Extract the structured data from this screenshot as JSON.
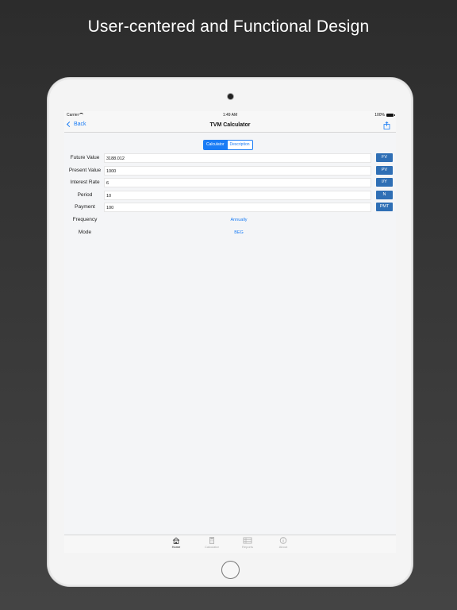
{
  "headline": "User-centered and Functional Design",
  "status_bar": {
    "carrier": "Carrier",
    "time": "1:49 AM",
    "battery": "100%"
  },
  "nav": {
    "back_label": "Back",
    "title": "TVM Calculator"
  },
  "segments": [
    {
      "label": "Calculator",
      "selected": true
    },
    {
      "label": "Description",
      "selected": false
    }
  ],
  "fields": [
    {
      "label": "Future Value",
      "value": "3188.012",
      "button": "FV"
    },
    {
      "label": "Present Value",
      "value": "1000",
      "button": "PV"
    },
    {
      "label": "Interest Rate",
      "value": "6",
      "button": "I/Y"
    },
    {
      "label": "Period",
      "value": "10",
      "button": "N"
    },
    {
      "label": "Payment",
      "value": "100",
      "button": "PMT"
    }
  ],
  "options": [
    {
      "label": "Frequency",
      "value": "Annually"
    },
    {
      "label": "Mode",
      "value": "BEG"
    }
  ],
  "tabs": [
    {
      "label": "Home",
      "icon": "home-icon",
      "active": true
    },
    {
      "label": "Calculator",
      "icon": "calculator-icon",
      "active": false
    },
    {
      "label": "Reports",
      "icon": "reports-icon",
      "active": false
    },
    {
      "label": "About",
      "icon": "info-icon",
      "active": false
    }
  ],
  "colors": {
    "accent": "#1a7cf5",
    "button": "#2f6fb5"
  }
}
